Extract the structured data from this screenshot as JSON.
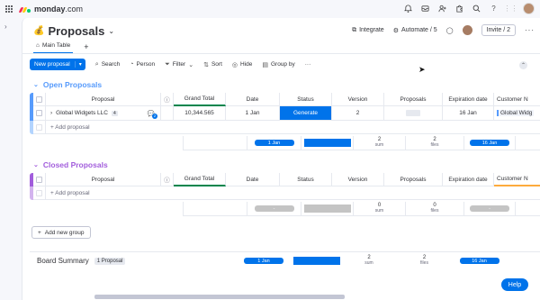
{
  "app": {
    "logo_name": "monday",
    "logo_suffix": ".com"
  },
  "topbar": {
    "icons": [
      "bell-icon",
      "inbox-icon",
      "people-icon",
      "apps-icon",
      "search-icon",
      "help-icon"
    ]
  },
  "board": {
    "title": "Proposals",
    "integrate_label": "Integrate",
    "automate_label": "Automate / 5",
    "invite_label": "Invite / 2",
    "more_label": "···"
  },
  "tabs": [
    {
      "label": "Main Table"
    }
  ],
  "add_view_label": "+",
  "toolbar": {
    "new_label": "New proposal",
    "search_label": "Search",
    "person_label": "Person",
    "filter_label": "Filter",
    "sort_label": "Sort",
    "hide_label": "Hide",
    "group_by_label": "Group by",
    "more_label": "···"
  },
  "columns": [
    "Proposal",
    "Grand Total",
    "Date",
    "Status",
    "Version",
    "Proposals",
    "Expiration date",
    "Customer N"
  ],
  "colors": {
    "accent": "#0073ea",
    "open_group": "#579bfc",
    "closed_group": "#a25ddc",
    "neutral": "#c4c4c4"
  },
  "groups": [
    {
      "title": "Open Proposals",
      "rows": [
        {
          "name": "Global Widgets LLC",
          "subitems": "4",
          "updates": "2",
          "grand_total": "10,344.565",
          "date": "1 Jan",
          "status": "Generate",
          "version": "2",
          "expiration": "16 Jan",
          "customer": "Global Widg"
        }
      ],
      "add_label": "+ Add proposal",
      "summary": {
        "date": "1 Jan",
        "version": "2",
        "version_sub": "sum",
        "proposals": "2",
        "proposals_sub": "files",
        "expiration": "16 Jan"
      }
    },
    {
      "title": "Closed Proposals",
      "rows": [],
      "add_label": "+ Add proposal",
      "summary": {
        "date": "-",
        "version": "0",
        "version_sub": "sum",
        "proposals": "0",
        "proposals_sub": "files",
        "expiration": "-"
      }
    }
  ],
  "add_group_label": "Add new group",
  "board_summary": {
    "label": "Board Summary",
    "count": "1 Proposal",
    "date": "1 Jan",
    "version": "2",
    "version_sub": "sum",
    "proposals": "2",
    "proposals_sub": "files",
    "expiration": "16 Jan"
  },
  "help_label": "Help"
}
